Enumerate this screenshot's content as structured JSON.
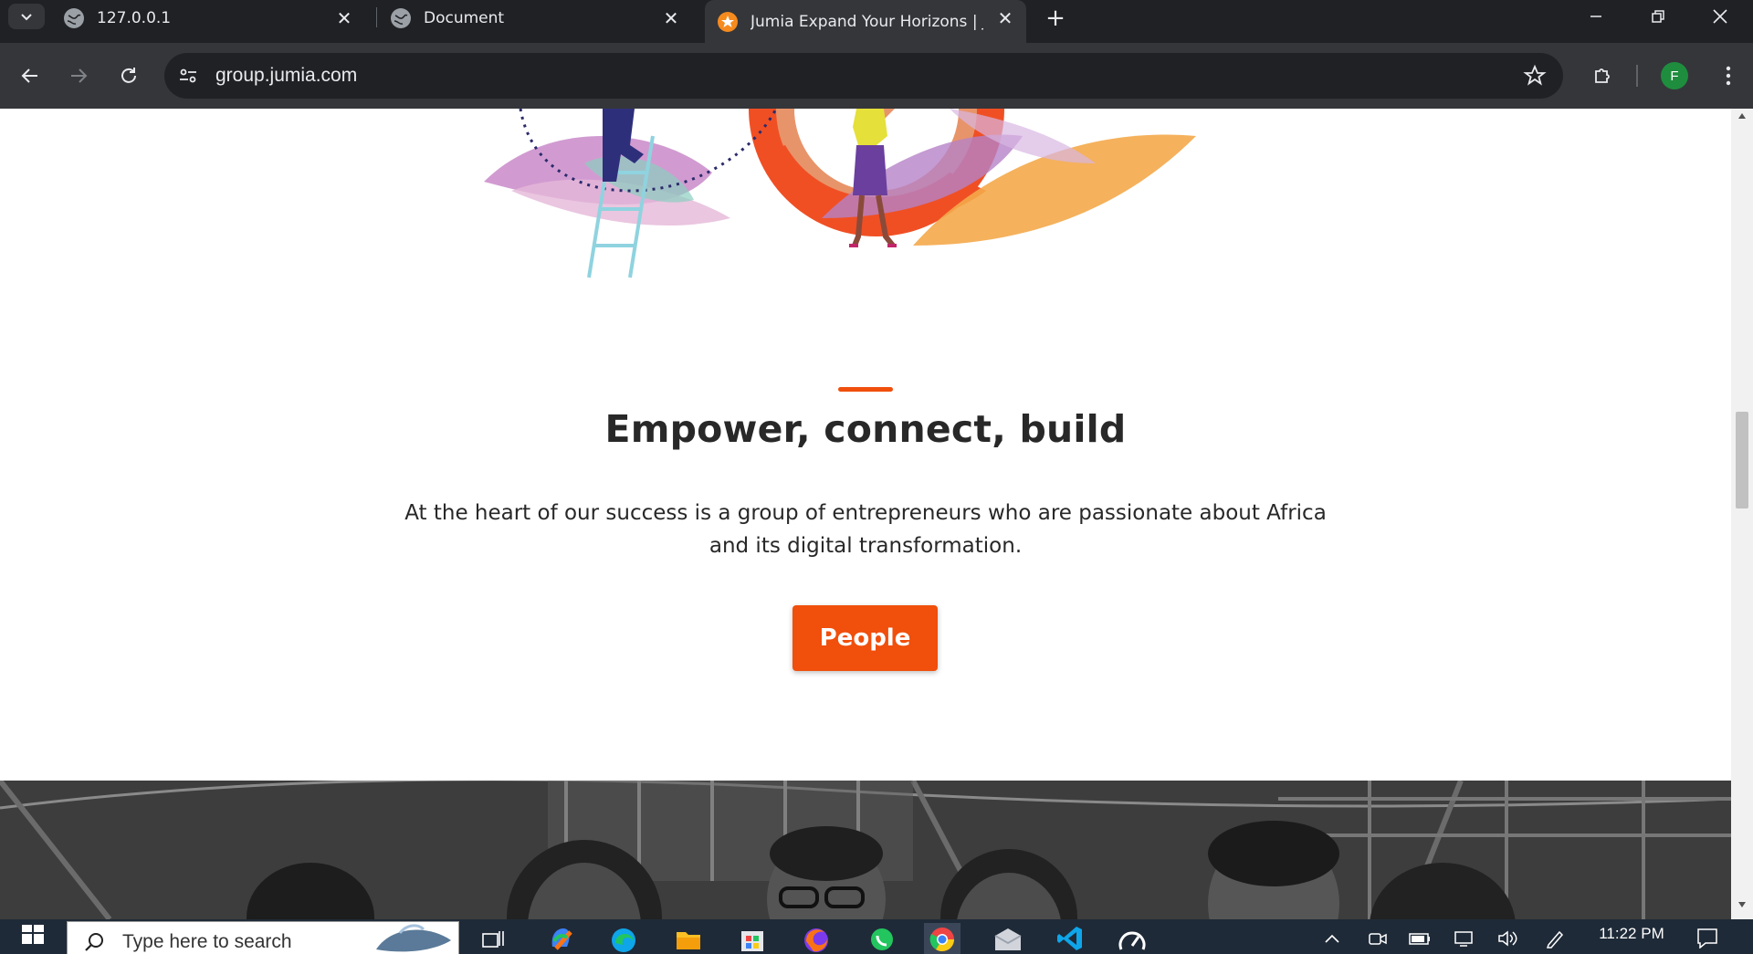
{
  "browser": {
    "tabs": [
      {
        "title": "127.0.0.1",
        "favicon": "globe-icon",
        "active": false
      },
      {
        "title": "Document",
        "favicon": "globe-icon",
        "active": false
      },
      {
        "title": "Jumia Expand Your Horizons | Ju",
        "favicon": "jumia-star-icon",
        "active": true
      }
    ],
    "url": "group.jumia.com",
    "profile_initial": "F"
  },
  "page": {
    "heading": "Empower, connect, build",
    "lead": "At the heart of our success is a group of entrepreneurs who are passionate about Africa and its digital transformation.",
    "cta_label": "People",
    "accent_color": "#f04f0c"
  },
  "taskbar": {
    "search_placeholder": "Type here to search",
    "apps": [
      "task-view-icon",
      "copilot-icon",
      "edge-icon",
      "file-explorer-icon",
      "microsoft-store-icon",
      "firefox-icon",
      "whatsapp-icon",
      "chrome-icon",
      "mail-icon",
      "vscode-icon",
      "speedtest-icon"
    ],
    "clock": "11:22 PM"
  }
}
